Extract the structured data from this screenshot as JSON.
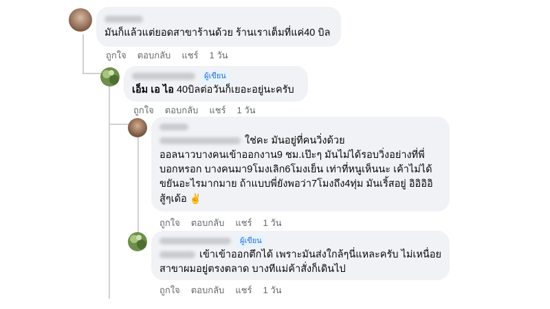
{
  "comments": [
    {
      "author_badge": "",
      "text_before": "มันก็แล้วแต่ยอดสาขาร้านด้วย ร้านเราเต็มที่แค่40 บิล",
      "actions": {
        "like": "ถูกใจ",
        "reply": "ตอบกลับ",
        "share": "แชร์",
        "time": "1 วัน"
      }
    },
    {
      "author_badge": "ผู้เขียน",
      "text_bold": "เอ็ม เอ ไอ",
      "text_before": " 40บิลต่อวันก็เยอะอยู่นะครับ",
      "actions": {
        "like": "ถูกใจ",
        "reply": "ตอบกลับ",
        "share": "แชร์",
        "time": "1 วัน"
      }
    },
    {
      "author_badge": "",
      "text_after_mention": "ใช่คะ มันอยู่ที่คนวิ่งด้วย",
      "text_before": "ออลนาวบางคนเข้าออกงาน9 ชม.เป๊ะๆ มันไม่ได้รอบวิ่งอย่างที่พี่บอกหรอก บางคนมา9โมงเลิก6โมงเย็น เท่าที่หนูเห็นนะ เค้าไม่ได้ขยันอะไรมากมาย ถ้าแบบพี่ยังพอว่า7โมงถึง4ทุ่ม มันเริ้สอยู่ อิอิอิอิ สู้ๆเด้อ",
      "emoji": "✌️",
      "actions": {
        "like": "ถูกใจ",
        "reply": "ตอบกลับ",
        "share": "แชร์",
        "time": "1 วัน"
      }
    },
    {
      "author_badge": "ผู้เขียน",
      "text_after_mention": "เข้าเข้าออกตึกได้ เพราะมันส่งใกล้ๆนี่แหละครับ ไม่เหนื่อย สาขาผมอยู่ตรงตลาด บางทีแม่ค้าสั่งก็เดินไป",
      "actions": {
        "like": "ถูกใจ",
        "reply": "ตอบกลับ",
        "share": "แชร์",
        "time": "1 วัน"
      }
    }
  ],
  "colors": {
    "bubble": "#f0f2f5",
    "badge_text": "#216fdb",
    "action_text": "#65676b"
  }
}
